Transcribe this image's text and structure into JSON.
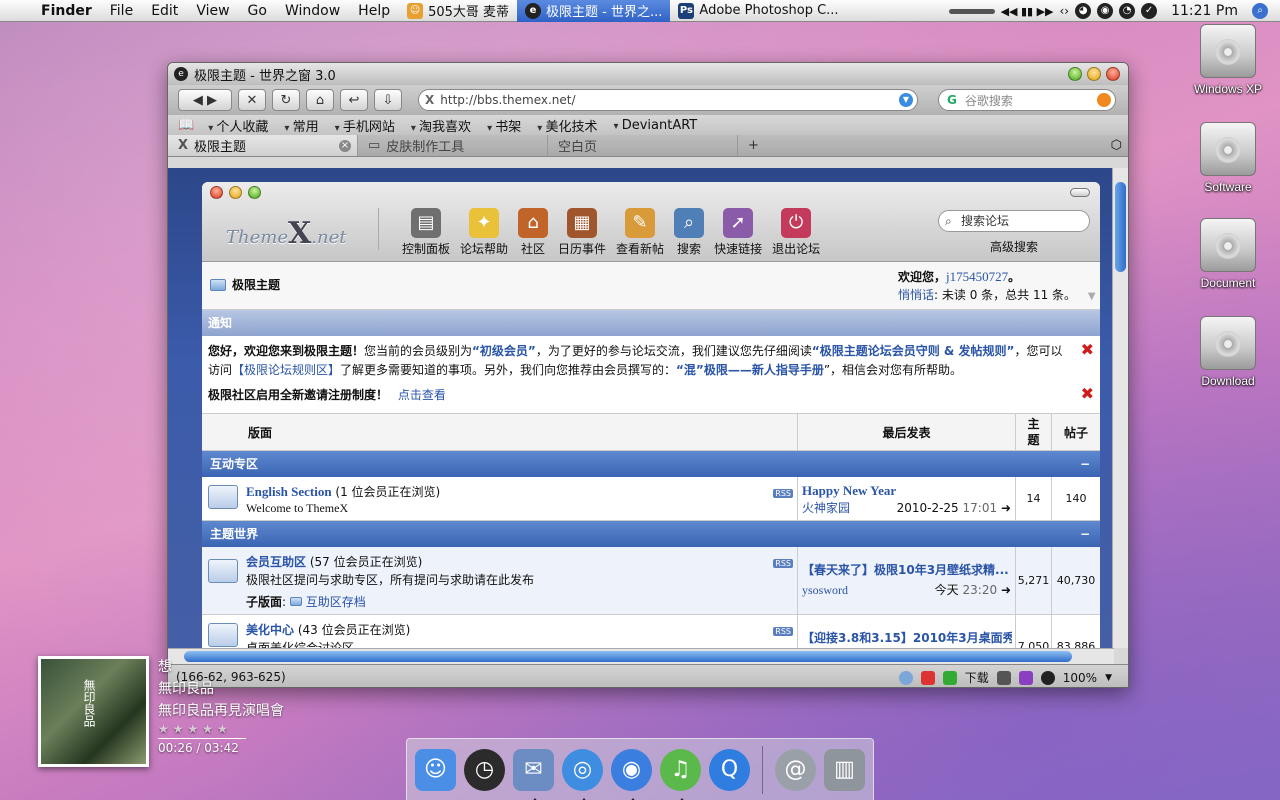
{
  "menubar": {
    "apple": "",
    "app": "Finder",
    "menus": [
      "File",
      "Edit",
      "View",
      "Go",
      "Window",
      "Help"
    ],
    "tasks": [
      {
        "label": "505大哥 麦蒂",
        "icon": "qq-icon",
        "active": false
      },
      {
        "label": "极限主题 - 世界之...",
        "icon": "browser-icon",
        "active": true
      },
      {
        "label": "Adobe Photoshop C...",
        "icon": "photoshop-icon",
        "active": false
      }
    ],
    "ps_badge": "Ps",
    "media_controls": "◀◀ ▮▮ ▶▶",
    "clock": "11:21 Pm"
  },
  "desktop_icons": [
    "Windows XP",
    "Software",
    "Document",
    "Download"
  ],
  "browser": {
    "window_title": "极限主题 - 世界之窗 3.0",
    "url": "http://bbs.themex.net/",
    "search_placeholder": "谷歌搜索",
    "bookmarks": [
      "个人收藏",
      "常用",
      "手机网站",
      "淘我喜欢",
      "书架",
      "美化技术",
      "DeviantART"
    ],
    "tabs": [
      "极限主题",
      "皮肤制作工具",
      "空白页"
    ],
    "status_coords": "(166-62, 963-625)",
    "status_download": "下载",
    "zoom": "100%"
  },
  "forum": {
    "logo": {
      "pre": "Theme",
      "x": "X",
      "post": ".net"
    },
    "tools": [
      {
        "label": "控制面板",
        "icon": "control-panel-icon",
        "color": "#6f6f6f"
      },
      {
        "label": "论坛帮助",
        "icon": "lightbulb-icon",
        "color": "#e9c23a"
      },
      {
        "label": "社区",
        "icon": "house-icon",
        "color": "#c0642a"
      },
      {
        "label": "日历事件",
        "icon": "calendar-icon",
        "color": "#a0552c"
      },
      {
        "label": "查看新帖",
        "icon": "new-posts-icon",
        "color": "#d99a3a"
      },
      {
        "label": "搜索",
        "icon": "magnifier-icon",
        "color": "#4f7fb6"
      },
      {
        "label": "快速链接",
        "icon": "quick-link-icon",
        "color": "#8a5ba8"
      },
      {
        "label": "退出论坛",
        "icon": "logout-icon",
        "color": "#c43a5c"
      }
    ],
    "search_placeholder": "搜索论坛",
    "advanced_search": "高级搜索",
    "breadcrumb": "极限主题",
    "welcome_prefix": "欢迎您，",
    "username": "j175450727",
    "welcome_suffix": "。",
    "pm_label": "悄悄话",
    "pm_text": ": 未读 0 条，总共 11 条。",
    "notice_title": "通知",
    "notice": {
      "p1": "您好，欢迎您来到极限主题！",
      "p2": "您当前的会员级别为",
      "level": "“初级会员”",
      "p3": "，为了更好的参与论坛交流，我们建议您先仔细阅读",
      "rules": "“极限主题论坛会员守则 & 发帖规则”",
      "p4": "，您可以访问",
      "rules_area": "【极限论坛规则区】",
      "p5": "了解更多需要知道的事项。另外，我们向您推荐由会员撰写的：",
      "guide": "“混”极限——新人指导手册",
      "p6": "”，相信会对您有所帮助。",
      "invite": "极限社区启用全新邀请注册制度！",
      "invite_link": "点击查看"
    },
    "columns": {
      "forum": "版面",
      "last_post": "最后发表",
      "topics": "主题",
      "posts": "帖子"
    },
    "categories": [
      {
        "name": "互动专区",
        "rows": [
          {
            "title": "English Section",
            "viewing": " (1 位会员正在浏览)",
            "desc": "Welcome to ThemeX",
            "sub_label": "",
            "sub": "",
            "last_title": "Happy New Year",
            "last_user": "火神家园",
            "last_date": "2010-2-25",
            "last_time": "17:01",
            "topics": "14",
            "posts": "140"
          }
        ]
      },
      {
        "name": "主题世界",
        "rows": [
          {
            "title": "会员互助区",
            "viewing": " (57 位会员正在浏览)",
            "desc": "极限社区提问与求助专区，所有提问与求助请在此发布",
            "sub_label": "子版面",
            "sub": "互助区存档",
            "last_title": "【春天来了】极限10年3月壁纸求精...",
            "last_user": "ysosword",
            "last_date": "今天",
            "last_time": "23:20",
            "topics": "5,271",
            "posts": "40,730"
          },
          {
            "title": "美化中心",
            "viewing": " (43 位会员正在浏览)",
            "desc": "桌面美化综合讨论区",
            "sub_label": "",
            "sub": "",
            "last_title": "【迎接3.8和3.15】2010年3月桌面秀...",
            "last_user": "",
            "last_date": "",
            "last_time": "",
            "topics": "7,050",
            "posts": "83,886"
          }
        ]
      }
    ],
    "rss": "RSS"
  },
  "music": {
    "cover_text": "無印良品",
    "title_char": "想",
    "artist": "無印良品",
    "album": "無印良品再見演唱會",
    "stars": "★★★★★",
    "time": "00:26 / 03:42"
  },
  "dock": [
    {
      "name": "finder",
      "icon": "finder-icon",
      "color": "#4a8ee6",
      "glyph": "☺"
    },
    {
      "name": "dashboard",
      "icon": "dashboard-icon",
      "color": "#2b2b2b",
      "glyph": "◷"
    },
    {
      "name": "mail",
      "icon": "mail-icon",
      "color": "#6c8cc4",
      "glyph": "✉"
    },
    {
      "name": "safari",
      "icon": "safari-icon",
      "color": "#3f8de0",
      "glyph": "◎"
    },
    {
      "name": "ichat",
      "icon": "ichat-icon",
      "color": "#3a7fe0",
      "glyph": "◉"
    },
    {
      "name": "itunes",
      "icon": "itunes-icon",
      "color": "#5ab94a",
      "glyph": "♫"
    },
    {
      "name": "quicktime",
      "icon": "quicktime-icon",
      "color": "#2f7de0",
      "glyph": "Q"
    },
    {
      "name": "downloads",
      "icon": "at-sign-icon",
      "color": "#9aa0a8",
      "glyph": "@"
    },
    {
      "name": "trash",
      "icon": "trash-icon",
      "color": "#8e959c",
      "glyph": "🗑"
    }
  ]
}
